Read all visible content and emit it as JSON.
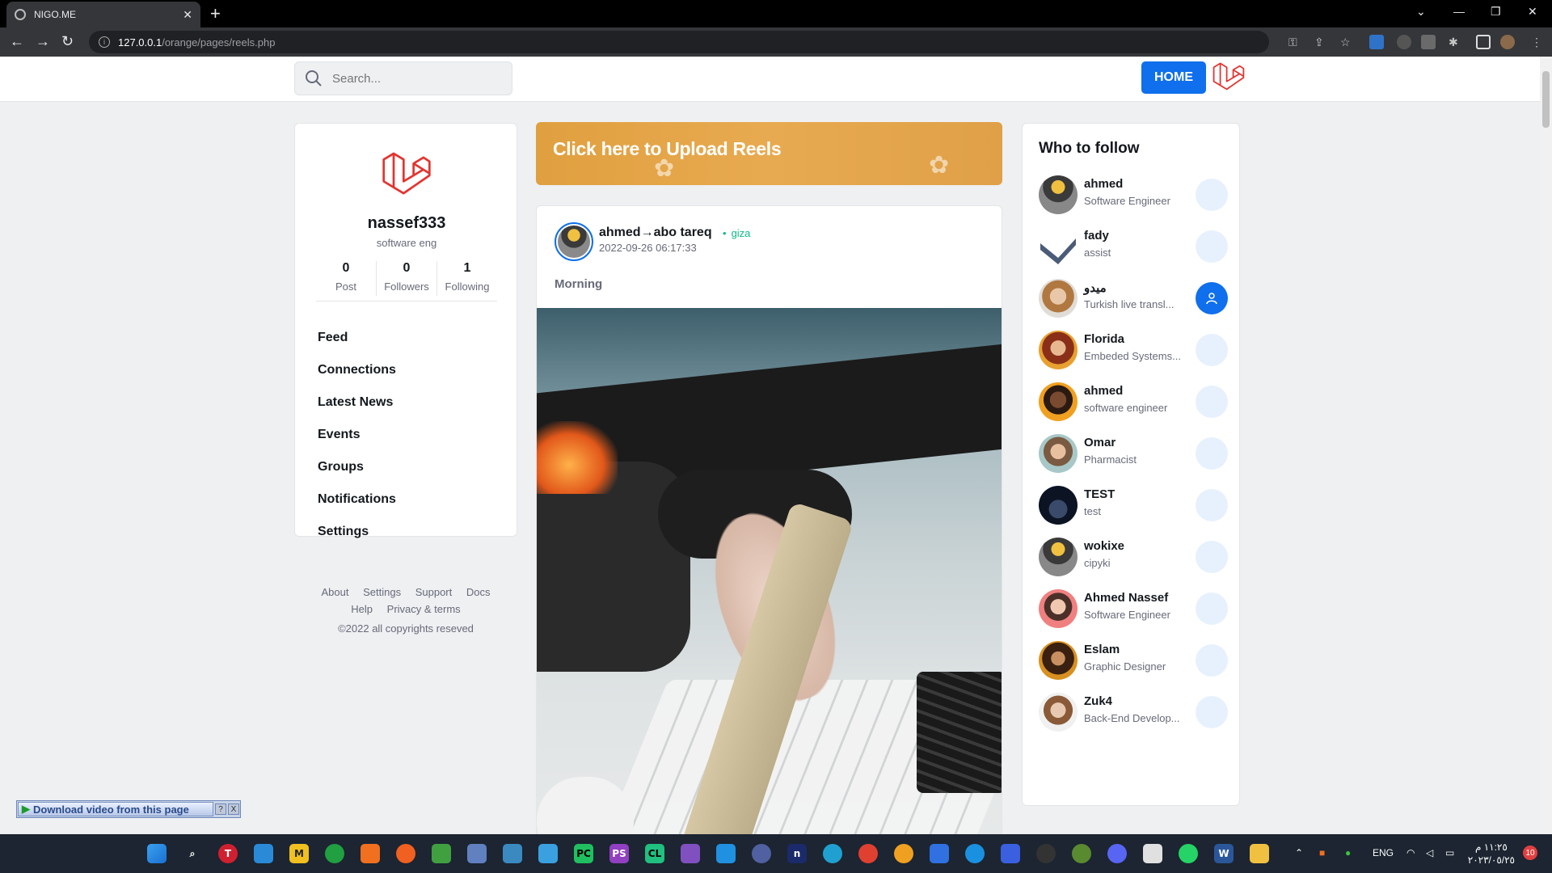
{
  "browser": {
    "tab_title": "NIGO.ME",
    "url_host": "127.0.0.1",
    "url_path": "/orange/pages/reels.php"
  },
  "topnav": {
    "search_placeholder": "Search...",
    "home_label": "HOME"
  },
  "profile": {
    "name": "nassef333",
    "role": "software eng",
    "stats": [
      {
        "num": "0",
        "label": "Post"
      },
      {
        "num": "0",
        "label": "Followers"
      },
      {
        "num": "1",
        "label": "Following"
      }
    ],
    "menu": [
      "Feed",
      "Connections",
      "Latest News",
      "Events",
      "Groups",
      "Notifications",
      "Settings"
    ]
  },
  "footer": {
    "links": [
      "About",
      "Settings",
      "Support",
      "Docs",
      "Help",
      "Privacy & terms"
    ],
    "copyright": "©2022 all copyrights reseved"
  },
  "upload_banner": "Click here to Upload Reels",
  "post": {
    "author": "ahmed→abo tareq",
    "location": "giza",
    "date": "2022-09-26 06:17:33",
    "caption": "Morning"
  },
  "who_to_follow": {
    "title": "Who to follow",
    "people": [
      {
        "name": "ahmed",
        "role": "Software Engineer",
        "avatar": "photo-dark"
      },
      {
        "name": "fady",
        "role": "assist",
        "avatar": "chevron-logo"
      },
      {
        "name": "ميدو",
        "role": "Turkish live transl...",
        "avatar": "photo-woman",
        "active": true
      },
      {
        "name": "Florida",
        "role": "Embeded Systems...",
        "avatar": "photo-woman-red"
      },
      {
        "name": "ahmed",
        "role": "software engineer",
        "avatar": "photo-man-orange"
      },
      {
        "name": "Omar",
        "role": "Pharmacist",
        "avatar": "photo-man-teal"
      },
      {
        "name": "TEST",
        "role": "test",
        "avatar": "photo-night"
      },
      {
        "name": "wokixe",
        "role": "cipyki",
        "avatar": "photo-dark"
      },
      {
        "name": "Ahmed Nassef",
        "role": "Software Engineer",
        "avatar": "photo-man-pink"
      },
      {
        "name": "Eslam",
        "role": "Graphic Designer",
        "avatar": "photo-man-curly"
      },
      {
        "name": "Zuk4",
        "role": "Back-End Develop...",
        "avatar": "photo-man-beard"
      }
    ]
  },
  "download_bar": {
    "label": "Download video from this page",
    "help": "?",
    "close": "X"
  },
  "taskbar": {
    "lang": "ENG",
    "time": "١١:٢٥ م",
    "date": "٢٠٢٣/٠٥/٢٥",
    "notif_count": "10"
  },
  "colors": {
    "primary": "#0f6fec",
    "success": "#0cbc87",
    "laravel_red": "#e3342f"
  }
}
